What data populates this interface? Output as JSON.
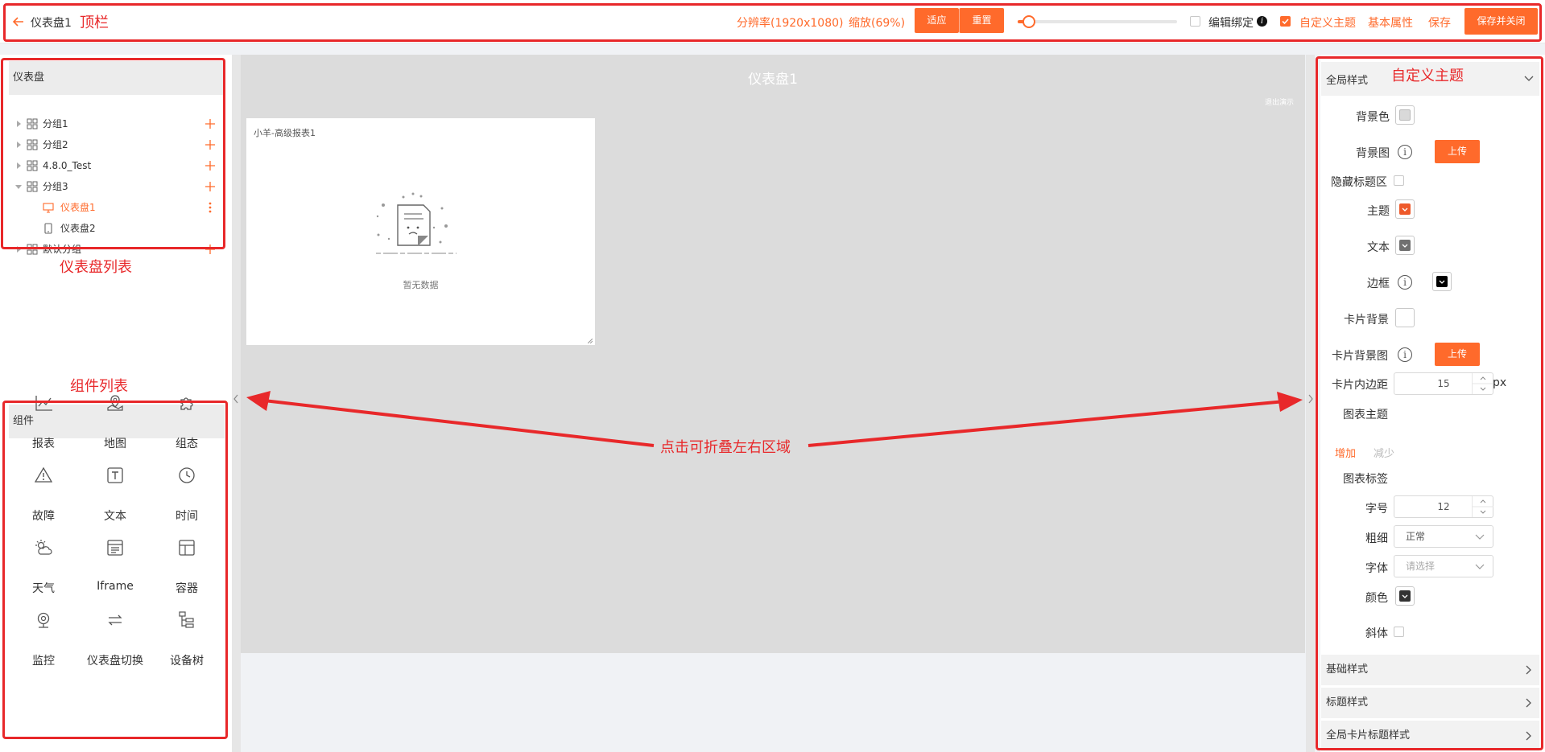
{
  "topbar": {
    "title": "仪表盘1",
    "annotation": "顶栏",
    "resolution": "分辨率(1920x1080)",
    "zoom": "缩放(69%)",
    "fit_label": "适应",
    "reset_label": "重置",
    "zoom_slider_value": 0.02,
    "edit_bind_label": "编辑绑定",
    "edit_bind_checked": false,
    "custom_theme_label": "自定义主题",
    "custom_theme_checked": true,
    "basic_props_label": "基本属性",
    "save_label": "保存",
    "save_close_label": "保存并关闭"
  },
  "dashboard_panel": {
    "header": "仪表盘",
    "annotation": "仪表盘列表",
    "items": [
      {
        "label": "分组1",
        "type": "group",
        "expanded": false
      },
      {
        "label": "分组2",
        "type": "group",
        "expanded": false
      },
      {
        "label": "4.8.0_Test",
        "type": "group",
        "expanded": false
      },
      {
        "label": "分组3",
        "type": "group",
        "expanded": true
      },
      {
        "label": "仪表盘1",
        "type": "dashboard-desktop",
        "active": true
      },
      {
        "label": "仪表盘2",
        "type": "dashboard-mobile",
        "active": false
      },
      {
        "label": "默认分组",
        "type": "group",
        "expanded": false
      }
    ]
  },
  "component_panel": {
    "header": "组件",
    "annotation": "组件列表",
    "items": [
      {
        "label": "报表",
        "icon": "line-chart-icon"
      },
      {
        "label": "地图",
        "icon": "map-icon"
      },
      {
        "label": "组态",
        "icon": "puzzle-icon"
      },
      {
        "label": "故障",
        "icon": "warning-icon"
      },
      {
        "label": "文本",
        "icon": "text-icon"
      },
      {
        "label": "时间",
        "icon": "clock-icon"
      },
      {
        "label": "天气",
        "icon": "weather-icon"
      },
      {
        "label": "Iframe",
        "icon": "iframe-icon"
      },
      {
        "label": "容器",
        "icon": "container-icon"
      },
      {
        "label": "监控",
        "icon": "camera-icon"
      },
      {
        "label": "仪表盘切换",
        "icon": "switch-icon"
      },
      {
        "label": "设备树",
        "icon": "tree-icon"
      }
    ]
  },
  "canvas": {
    "title": "仪表盘1",
    "exit_demo": "退出演示",
    "card_title": "小羊-高级报表1",
    "empty_text": "暂无数据",
    "collapse_annotation": "点击可折叠左右区域"
  },
  "theme_panel": {
    "annotation": "自定义主题",
    "global_style": "全局样式",
    "bg_color_label": "背景色",
    "bg_color": "#d9d9d9",
    "bg_image_label": "背景图",
    "upload_label": "上传",
    "hide_title_label": "隐藏标题区",
    "theme_label": "主题",
    "theme_color": "#ee5a2b",
    "text_label": "文本",
    "text_color": "#707070",
    "border_label": "边框",
    "border_color": "#000000",
    "card_bg_label": "卡片背景",
    "card_bg_color": "#ffffff",
    "card_bg_image_label": "卡片背景图",
    "card_padding_label": "卡片内边距",
    "card_padding_value": "15",
    "px_unit": "px",
    "chart_theme_label": "图表主题",
    "add_label": "增加",
    "reduce_label": "减少",
    "chart_tag_label": "图表标签",
    "font_size_label": "字号",
    "font_size_value": "12",
    "weight_label": "粗细",
    "weight_value": "正常",
    "font_label": "字体",
    "font_placeholder": "请选择",
    "color_label": "颜色",
    "color_value": "#333333",
    "italic_label": "斜体",
    "sections": [
      "基础样式",
      "标题样式",
      "全局卡片标题样式"
    ]
  },
  "colors": {
    "accent": "#ff6a2b",
    "annotation": "#e8282a"
  }
}
